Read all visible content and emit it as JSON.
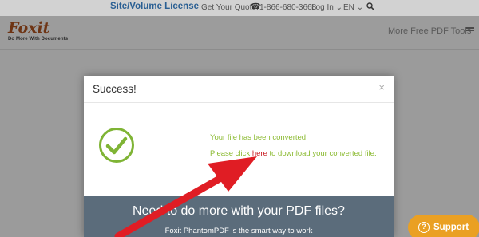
{
  "topbar": {
    "site_license": "Site/Volume License",
    "quote_label": "Get Your Quote:",
    "phone": "1-866-680-3668",
    "login": "Log In",
    "language": "EN"
  },
  "header": {
    "logo_mark": "Foxit",
    "logo_tagline": "Do More With Documents",
    "tools_label": "More Free PDF Tools"
  },
  "modal": {
    "title": "Success!",
    "close": "×",
    "message_line1": "Your file has been converted.",
    "message_line2_before": "Please click ",
    "message_link": "here",
    "message_line2_after": " to download your converted file.",
    "promo_heading": "Need to do more with your PDF files?",
    "promo_sub": "Foxit PhantomPDF is the smart way to work"
  },
  "support": {
    "label": "Support",
    "icon": "?"
  },
  "colors": {
    "accent_green": "#8cbb33",
    "link_red": "#c91f26",
    "arrow_red": "#e01d24",
    "support_orange": "#eaa023",
    "promo_slate": "#5b6c7b"
  }
}
